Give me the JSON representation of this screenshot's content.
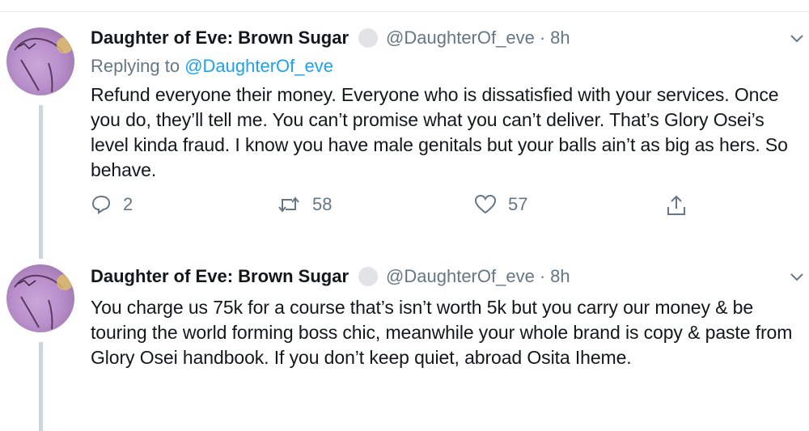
{
  "colors": {
    "text": "#14171a",
    "muted": "#657786",
    "link": "#1da1f2",
    "thread": "#ccd6dd"
  },
  "tweets": [
    {
      "author_name": "Daughter of Eve: Brown Sugar",
      "handle": "@DaughterOf_eve",
      "separator": "·",
      "time": "8h",
      "replying_prefix": "Replying to",
      "replying_mention": "@DaughterOf_eve",
      "text": "Refund everyone their money. Everyone who is dissatisfied with your services. Once you do, they’ll tell me. You can’t promise what you can’t deliver. That’s Glory Osei’s level kinda fraud. I know you have male genitals but your balls ain’t as big as hers. So behave.",
      "replies": "2",
      "retweets": "58",
      "likes": "57",
      "icons": [
        "reply-icon",
        "retweet-icon",
        "like-icon",
        "share-icon",
        "chevron-down-icon"
      ]
    },
    {
      "author_name": "Daughter of Eve: Brown Sugar",
      "handle": "@DaughterOf_eve",
      "separator": "·",
      "time": "8h",
      "text": "You charge us 75k for a course that’s isn’t worth 5k but you carry our money & be touring the world forming boss chic, meanwhile your whole brand is copy & paste from Glory Osei handbook. If you don’t keep quiet, abroad Osita Iheme.",
      "icons": [
        "chevron-down-icon"
      ]
    }
  ]
}
